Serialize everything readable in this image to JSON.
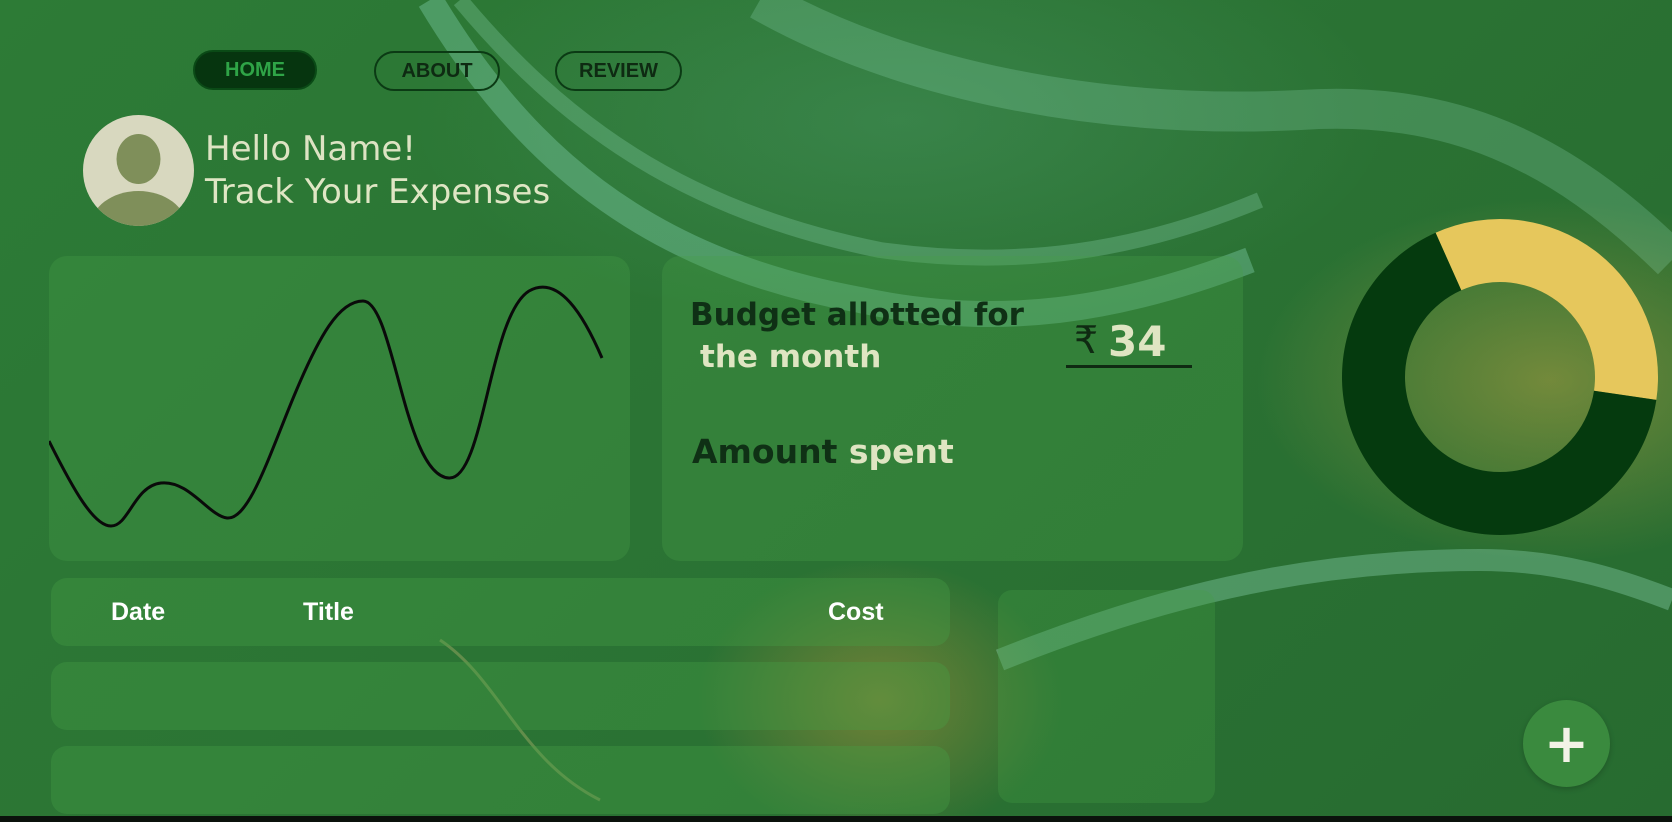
{
  "nav": {
    "home": "HOME",
    "about": "ABOUT",
    "review": "REVIEW"
  },
  "header": {
    "greeting": "Hello Name!",
    "tagline": "Track Your Expenses"
  },
  "budget": {
    "label_line1": "Budget allotted for",
    "label_line2": "the month",
    "currency_symbol": "₹",
    "amount": "34",
    "spent_word1": "Amount",
    "spent_word2": "spent"
  },
  "table": {
    "columns": [
      "Date",
      "Title",
      "Cost"
    ]
  },
  "donut": {
    "segments": [
      {
        "fraction": 0.34,
        "color": "#e6c75c"
      },
      {
        "fraction": 0.66,
        "color": "#053a0e"
      }
    ]
  },
  "fab": {
    "label": "+"
  },
  "colors": {
    "accent_dark": "#053a0e",
    "accent_gold": "#e6c75c",
    "text_light": "#dfe5c2"
  },
  "icons": {
    "avatar": "user-silhouette-icon",
    "fab": "plus-icon"
  }
}
